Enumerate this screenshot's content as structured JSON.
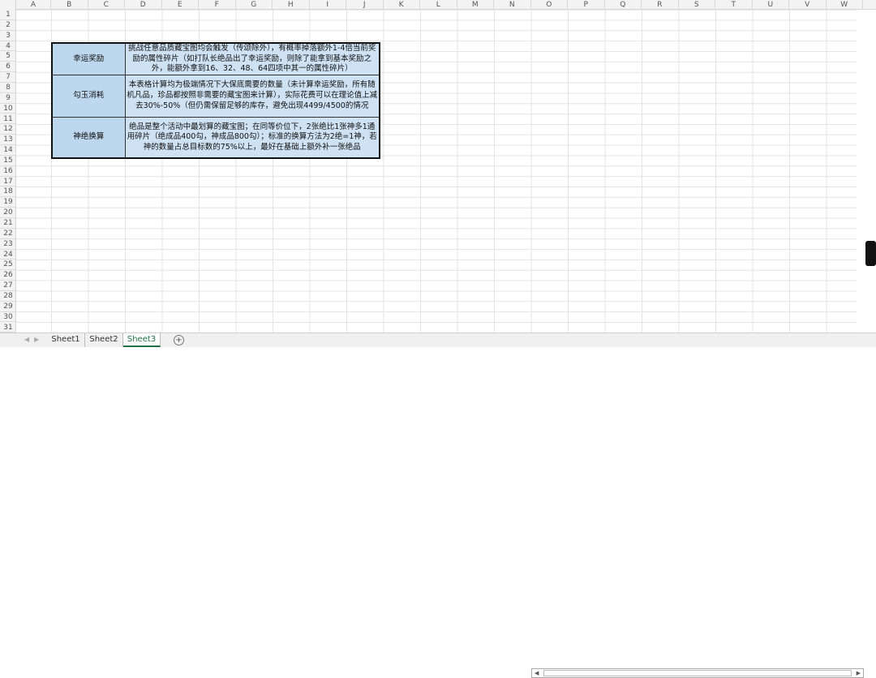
{
  "columns": [
    "A",
    "B",
    "C",
    "D",
    "E",
    "F",
    "G",
    "H",
    "I",
    "J",
    "K",
    "L",
    "M",
    "N",
    "O",
    "P",
    "Q",
    "R",
    "S",
    "T",
    "U",
    "V",
    "W"
  ],
  "row_count": 31,
  "table": [
    {
      "label": "幸运奖励",
      "text": "挑战任意品质藏宝图均会触发（传颂除外），有概率掉落额外1-4倍当前奖励的属性碎片（如打队长绝品出了幸运奖励，则除了能拿到基本奖励之外，能额外拿到16、32、48、64四项中其一的属性碎片）"
    },
    {
      "label": "勾玉消耗",
      "text": "本表格计算均为极端情况下大保底需要的数量（未计算幸运奖励，所有随机凡品，珍品都按照非需要的藏宝图来计算），实际花费可以在理论值上减去30%-50%（但仍需保留足够的库存，避免出现4499/4500的情况"
    },
    {
      "label": "神绝换算",
      "text": "绝品是整个活动中最划算的藏宝图；在同等价位下，2张绝比1张神多1通用碎片（绝成品400勾，神成品800勾）；标准的换算方法为2绝=1神，若神的数量占总目标数的75%以上，最好在基础上额外补一张绝品"
    }
  ],
  "sheets": [
    {
      "name": "Sheet1",
      "active": false
    },
    {
      "name": "Sheet2",
      "active": false
    },
    {
      "name": "Sheet3",
      "active": true
    }
  ],
  "add_sheet": "+",
  "colors": {
    "label_bg": "#bdd7ee",
    "cell_bg": "#cfe2f3",
    "active_tab": "#1e7145"
  }
}
